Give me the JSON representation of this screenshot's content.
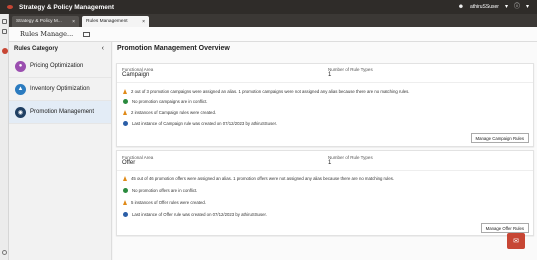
{
  "app": {
    "title": "Strategy & Policy Management",
    "user": "athiruSSuser"
  },
  "tabs": [
    {
      "label": "Strategy & Policy M..."
    },
    {
      "label": "Rules Management"
    }
  ],
  "subheader": {
    "name": "Rules Manage..."
  },
  "sidebar": {
    "heading": "Rules Category",
    "items": [
      {
        "label": "Pricing Optimization",
        "color": "#9b4fb0"
      },
      {
        "label": "Inventory Optimization",
        "color": "#2b7bbf"
      },
      {
        "label": "Promotion Management",
        "color": "#1f3f63"
      }
    ]
  },
  "main": {
    "title": "Promotion Management Overview",
    "cards": [
      {
        "area_label": "Functional Area",
        "area_value": "Campaign",
        "count_label": "Number of Rule Types",
        "count_value": "1",
        "lines": [
          {
            "icon": "warning",
            "text": "2 out of 3 promotion campaigns were assigned an alias. 1 promotion campaigns were not assigned any alias because there are no matching rules."
          },
          {
            "icon": "ok",
            "text": "No promotion campaigns are in conflict."
          },
          {
            "icon": "warning",
            "text": "2 instances of Campaign rules were created."
          },
          {
            "icon": "info",
            "text": "Last instance of Campaign rule was created on 07/12/2023 by athiruSSuser."
          }
        ],
        "button": "Manage Campaign Rules"
      },
      {
        "area_label": "Functional Area",
        "area_value": "Offer",
        "count_label": "Number of Rule Types",
        "count_value": "1",
        "lines": [
          {
            "icon": "warning",
            "text": "45 out of 46 promotion offers were assigned an alias. 1 promotion offers were not assigned any alias because there are no matching rules."
          },
          {
            "icon": "ok",
            "text": "No promotion offers are in conflict."
          },
          {
            "icon": "warning",
            "text": "5 instances of Offer rules were created."
          },
          {
            "icon": "info",
            "text": "Last instance of Offer rule was created on 07/12/2023 by athiruSSuser."
          }
        ],
        "button": "Manage Offer Rules"
      }
    ]
  },
  "colors": {
    "brand": "#c74634",
    "appbar": "#2f2c29",
    "selected": "#e3ecf6"
  }
}
